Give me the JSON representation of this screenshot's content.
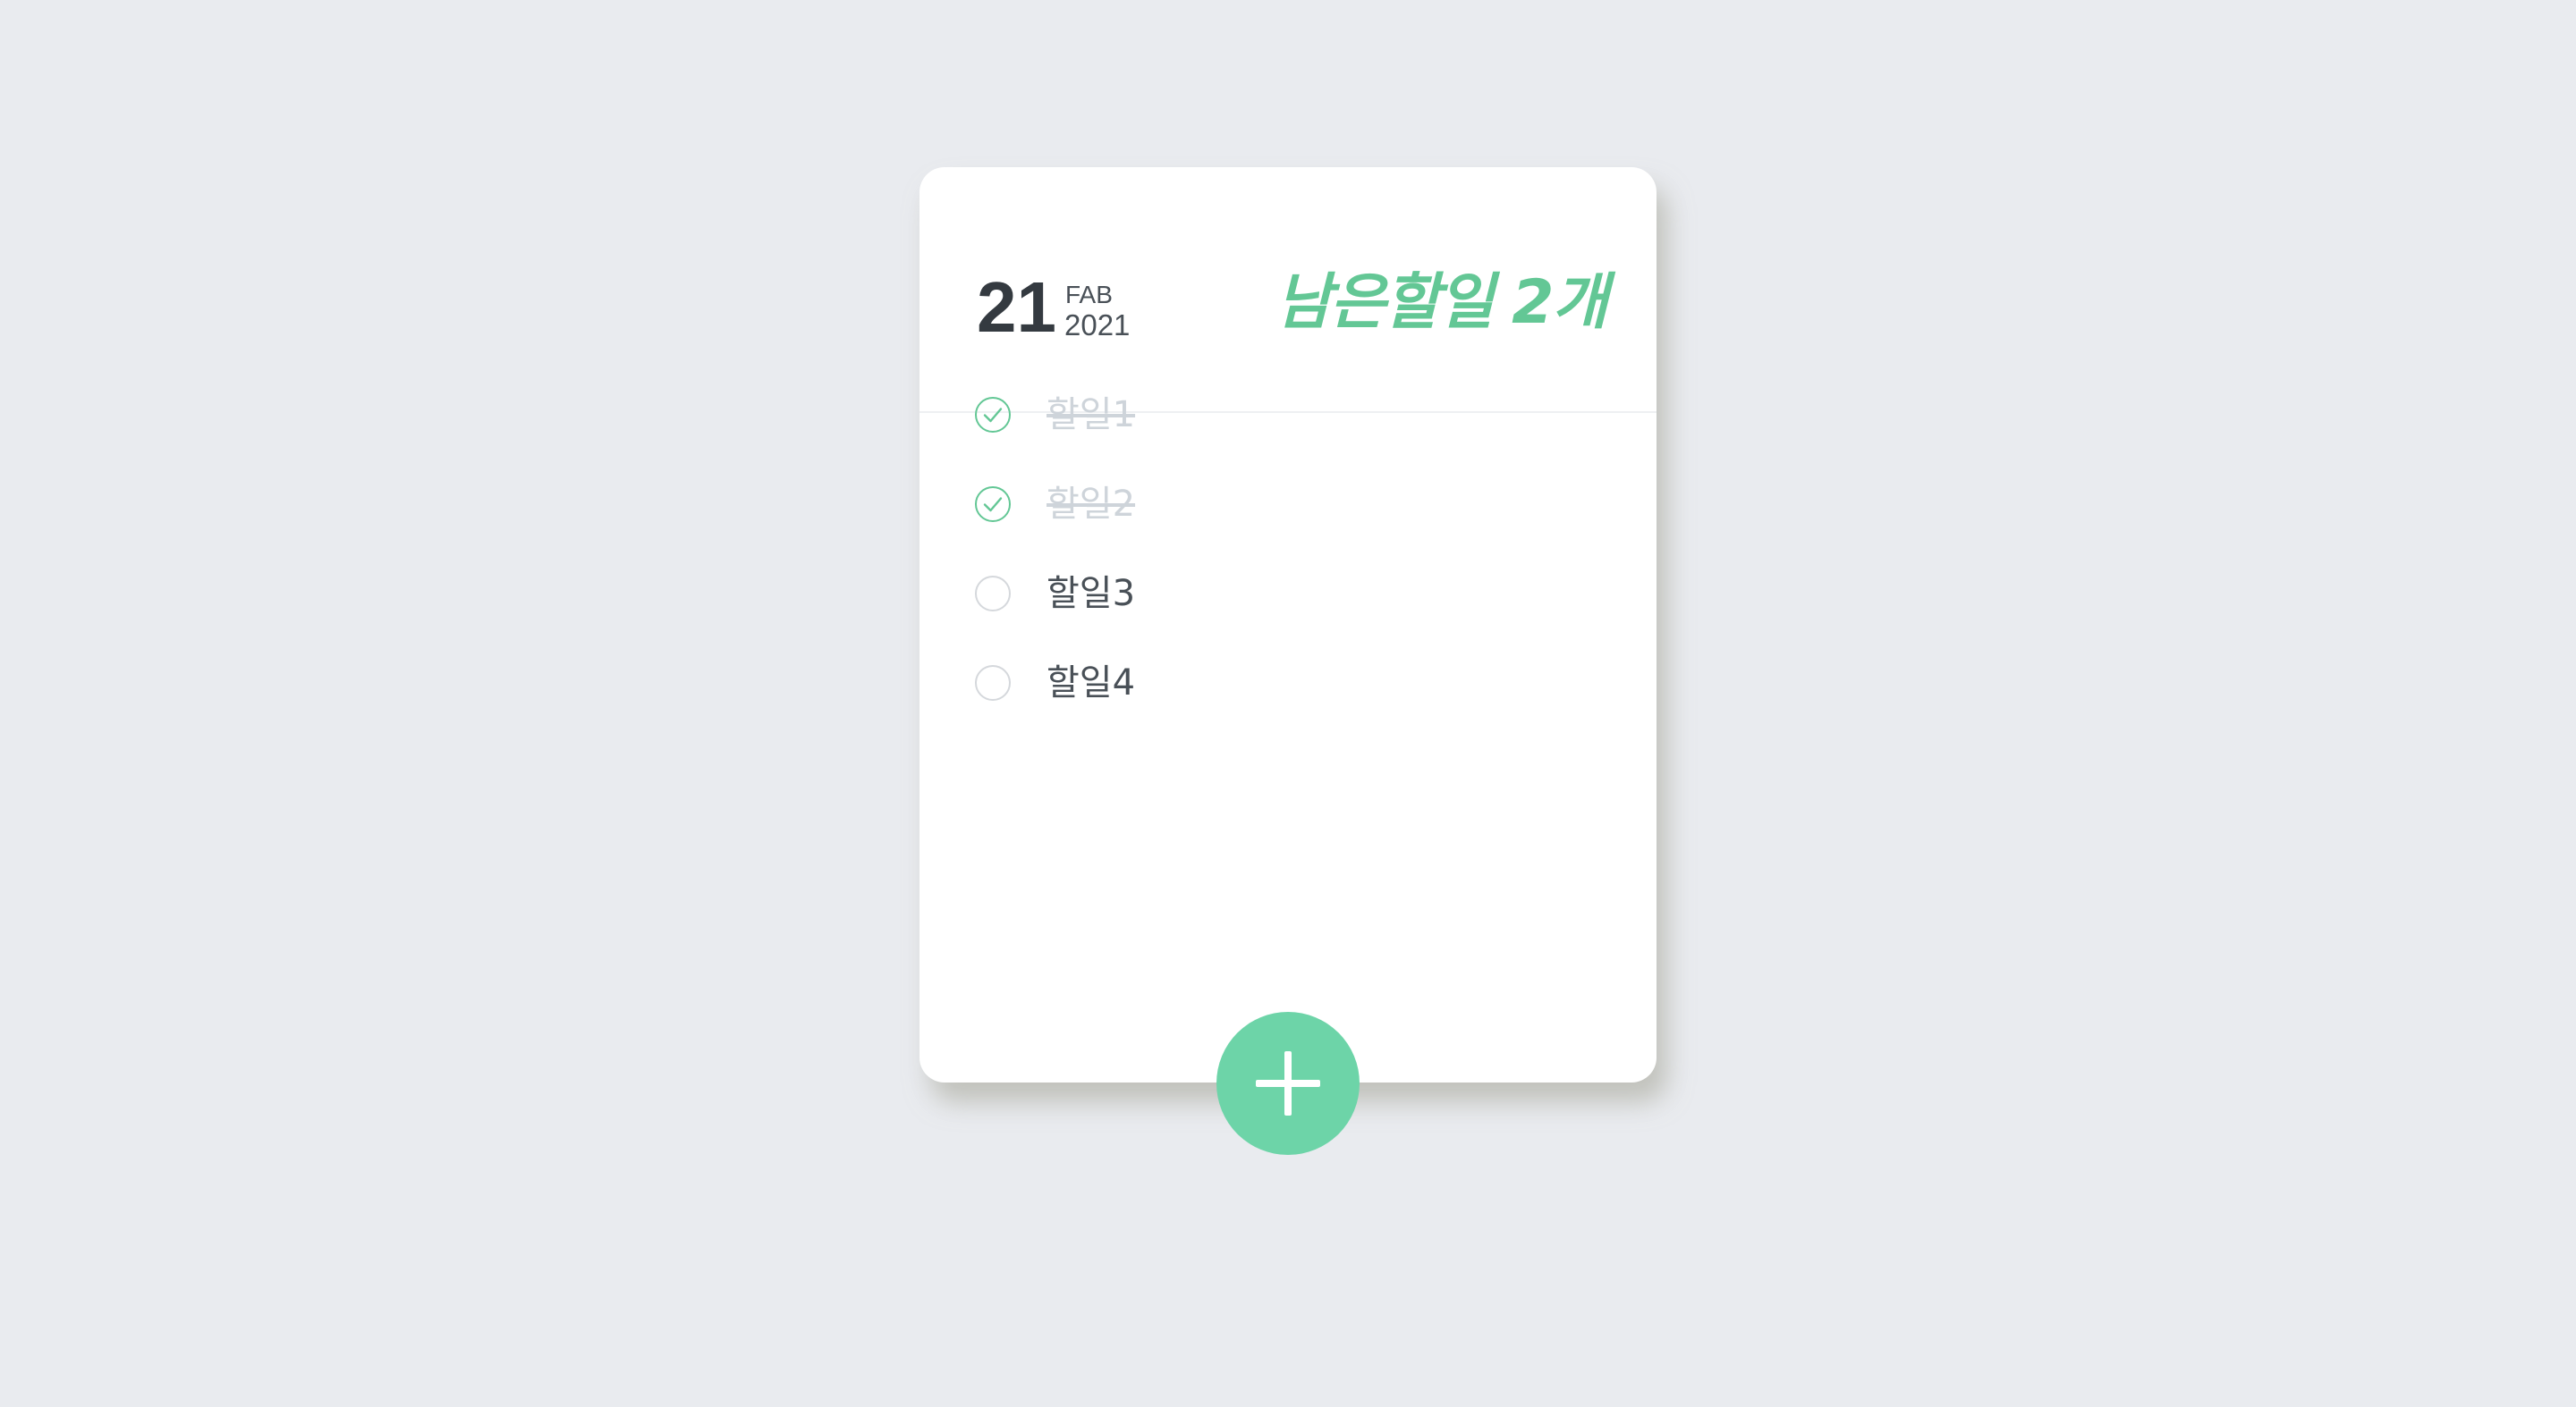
{
  "header": {
    "day": "21",
    "month": "FAB",
    "year": "2021",
    "remaining_label": "남은할일 2개"
  },
  "todos": [
    {
      "text": "할일1",
      "done": true
    },
    {
      "text": "할일2",
      "done": true
    },
    {
      "text": "할일3",
      "done": false
    },
    {
      "text": "할일4",
      "done": false
    }
  ],
  "add_button": {
    "icon": "plus-icon"
  },
  "colors": {
    "background": "#e9ebef",
    "accent": "#63c795",
    "button": "#6dd4a8",
    "text": "#495057",
    "done_text": "#ced4da"
  }
}
